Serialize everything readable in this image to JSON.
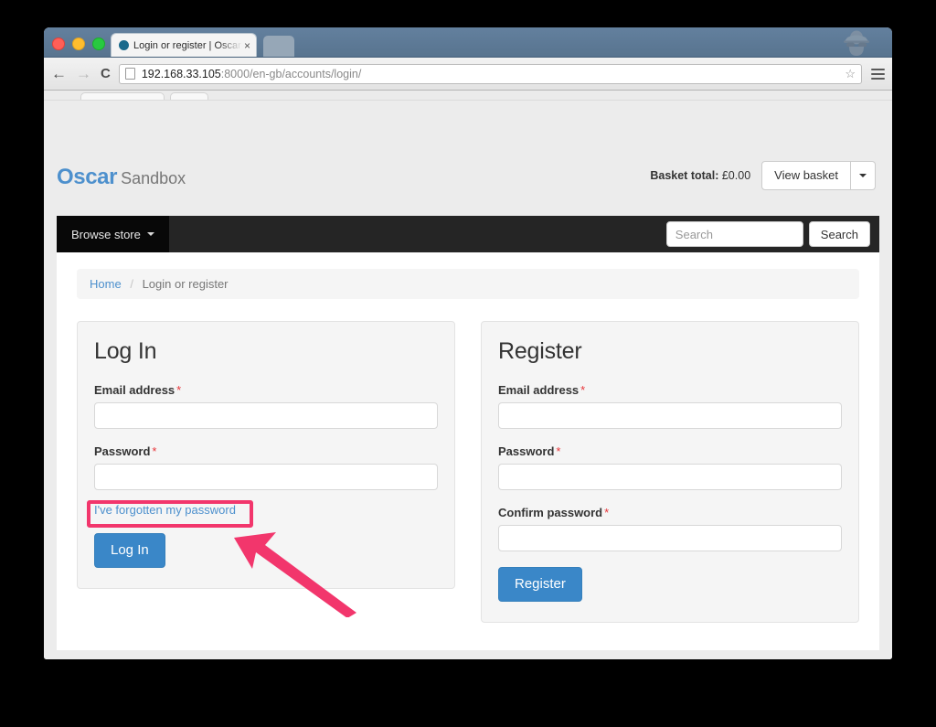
{
  "browser": {
    "tab": {
      "title": "Login or register | Oscar - S",
      "close_label": "×",
      "favicon": "circle-favicon"
    },
    "new_tab_label": "+",
    "nav": {
      "back": "←",
      "forward": "→",
      "reload": "C"
    },
    "omnibox": {
      "url_host": "192.168.33.105",
      "url_rest": ":8000/en-gb/accounts/login/",
      "star": "☆"
    },
    "incognito_icon": "incognito-icon",
    "menu_icon": "hamburger-menu-icon"
  },
  "site": {
    "brand": {
      "primary": "Oscar",
      "secondary": "Sandbox"
    },
    "basket": {
      "label": "Basket total:",
      "amount": "£0.00",
      "view_button": "View basket",
      "dropdown_icon": "caret-down-icon"
    },
    "navbar": {
      "browse_store": "Browse store",
      "browse_caret": "caret-down-icon",
      "search_placeholder": "Search",
      "search_value": "",
      "search_button": "Search"
    },
    "breadcrumb": {
      "home": "Home",
      "separator": "/",
      "current": "Login or register"
    }
  },
  "login_panel": {
    "heading": "Log In",
    "email_label": "Email address",
    "email_required": "*",
    "email_value": "",
    "password_label": "Password",
    "password_required": "*",
    "password_value": "",
    "forgot_link": "I've forgotten my password",
    "submit_button": "Log In"
  },
  "register_panel": {
    "heading": "Register",
    "email_label": "Email address",
    "email_required": "*",
    "email_value": "",
    "password_label": "Password",
    "password_required": "*",
    "password_value": "",
    "confirm_label": "Confirm password",
    "confirm_required": "*",
    "confirm_value": "",
    "submit_button": "Register"
  },
  "annotation": {
    "highlight_color": "#f2366c",
    "arrow_color": "#f2366c",
    "target": "I've forgotten my password"
  },
  "colors": {
    "brand_blue": "#4d90cd",
    "primary_button": "#3a87c8",
    "navbar_black": "#252525",
    "page_background": "#ececec",
    "required_red": "#e8363a"
  }
}
